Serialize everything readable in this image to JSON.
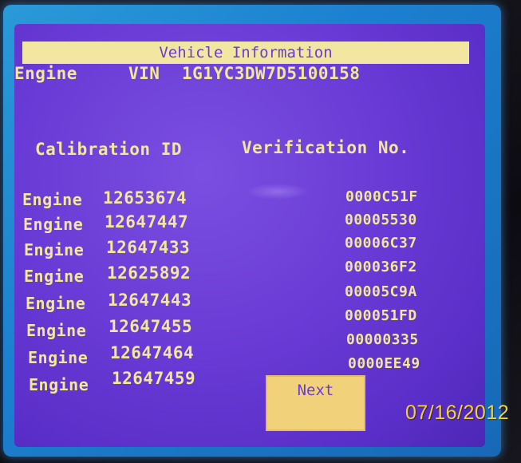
{
  "screen": {
    "title": "Vehicle Information",
    "engine_label": "Engine",
    "vin_label": "VIN",
    "vin_value": "1G1YC3DW7D5100158",
    "col_calibration": "Calibration ID",
    "col_verification": "Verification No.",
    "rows": [
      {
        "label": "Engine",
        "calibration_id": "12653674",
        "verification_no": "0000C51F"
      },
      {
        "label": "Engine",
        "calibration_id": "12647447",
        "verification_no": "00005530"
      },
      {
        "label": "Engine",
        "calibration_id": "12647433",
        "verification_no": "00006C37"
      },
      {
        "label": "Engine",
        "calibration_id": "12625892",
        "verification_no": "000036F2"
      },
      {
        "label": "Engine",
        "calibration_id": "12647443",
        "verification_no": "00005C9A"
      },
      {
        "label": "Engine",
        "calibration_id": "12647455",
        "verification_no": "000051FD"
      },
      {
        "label": "Engine",
        "calibration_id": "12647464",
        "verification_no": "00000335"
      },
      {
        "label": "Engine",
        "calibration_id": "12647459",
        "verification_no": "0000EE49"
      }
    ],
    "next_label": "Next"
  },
  "photo": {
    "datestamp": "07/16/2012"
  },
  "colors": {
    "screen_bg": "#6a3bd6",
    "text": "#f4e79a",
    "title_bar": "#f2e6a0",
    "button": "#f1d27a",
    "bezel": "#1c7fcf",
    "datestamp": "#f3d230"
  }
}
